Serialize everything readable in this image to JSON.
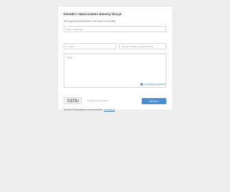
{
  "form": {
    "title": "Kontakt z właścicielem domeny bicz.pl",
    "required_note": "Wymagane jest wszystkie zaznaczone pola/tłky",
    "name_placeholder": "Imię i nazwisko *",
    "email_placeholder": "E-mail *",
    "phone_placeholder": "Numer telefonu (opcjonalnie)",
    "message_placeholder": "Treść *",
    "terms_label": "Akceptuję regulamin",
    "captcha_text": "5AT4z",
    "captcha_input_label": "Przepisz wyrażenie",
    "send_label": "WYŚLIJ"
  },
  "footer": {
    "text": "Domena utrzymywana na serwerach",
    "link": "domeny.pl"
  },
  "colors": {
    "accent": "#4a8fcf",
    "background": "#eeeeee",
    "card": "#ffffff"
  }
}
